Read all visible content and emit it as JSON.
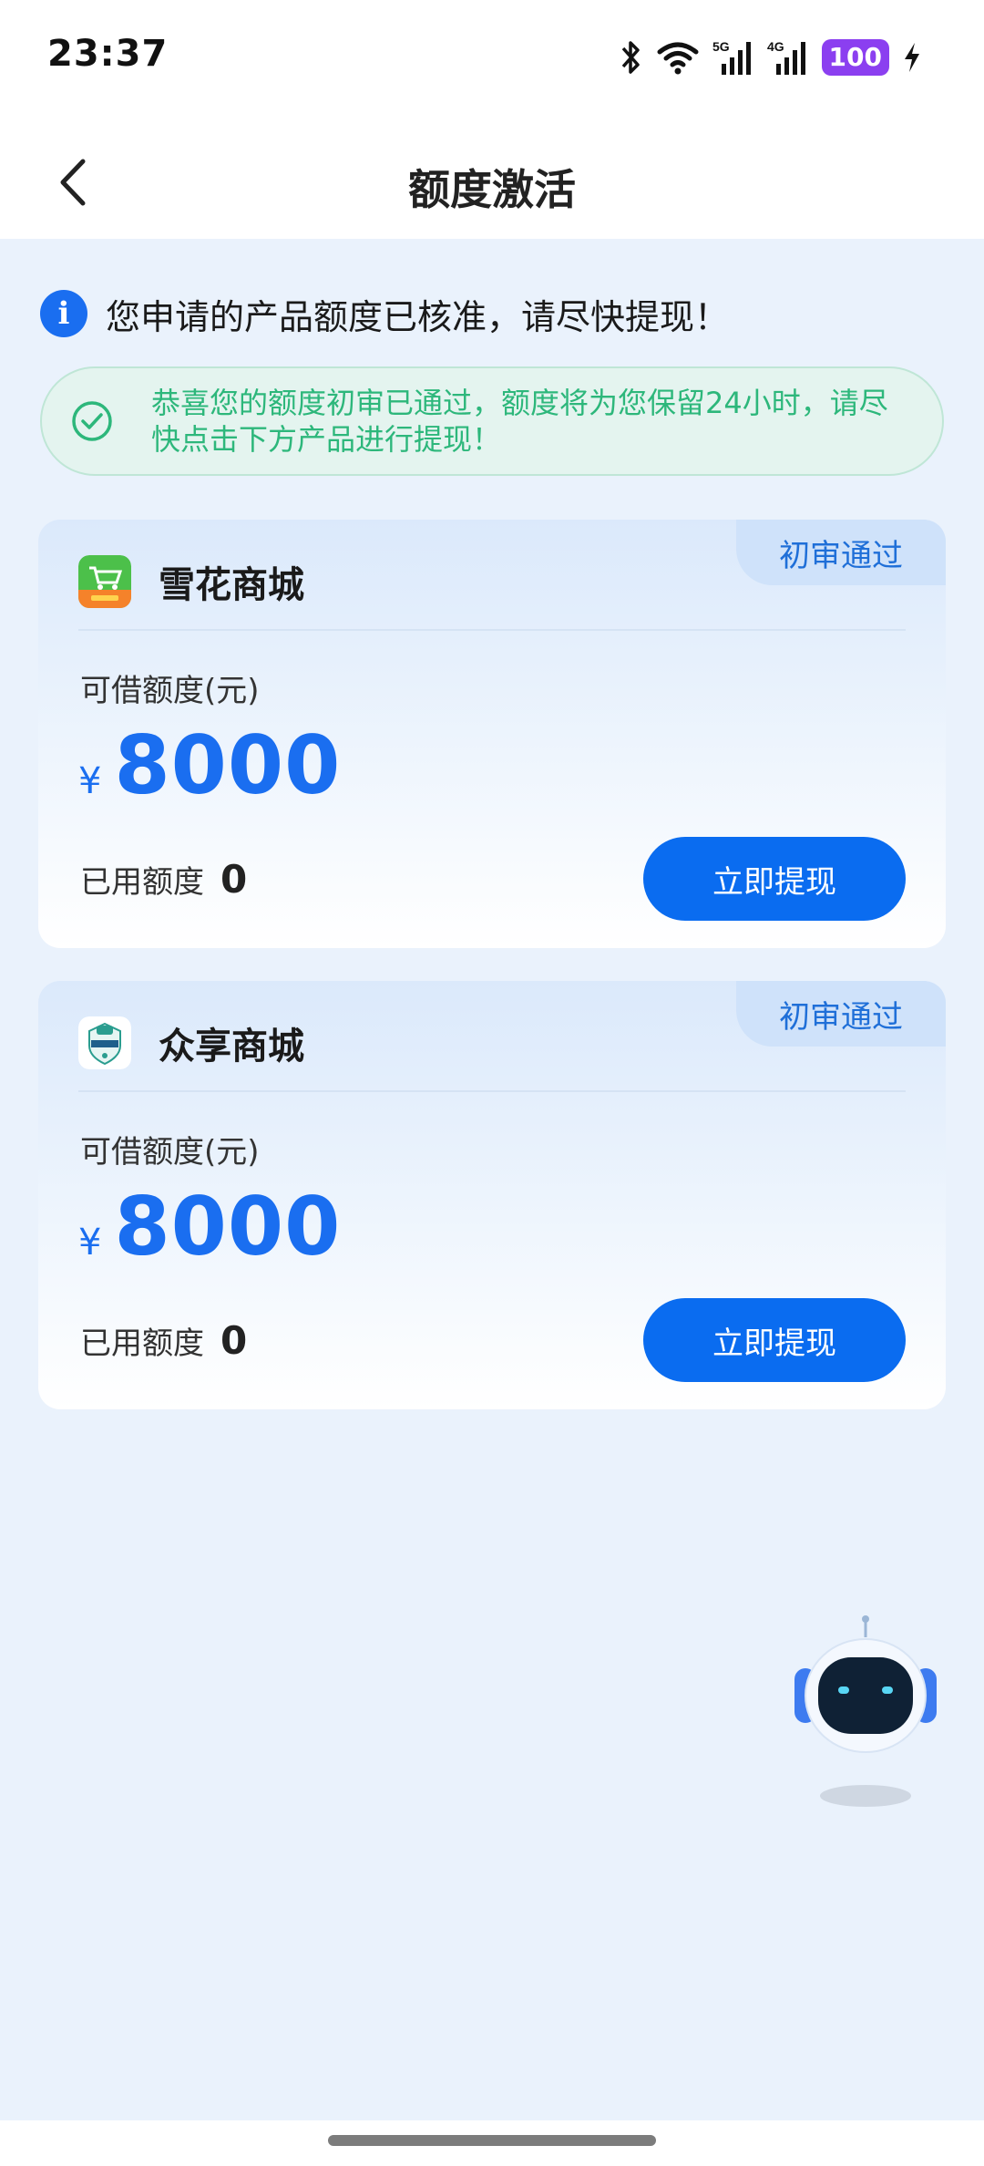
{
  "status_bar": {
    "time": "23:37",
    "battery": "100",
    "icons": [
      "bluetooth-icon",
      "wifi-icon",
      "signal-5g-icon",
      "signal-4g-icon",
      "battery-icon",
      "charging-icon"
    ]
  },
  "nav": {
    "title": "额度激活",
    "back_icon": "chevron-left-icon"
  },
  "notice": {
    "text": "您申请的产品额度已核准，请尽快提现！",
    "icon": "info-icon"
  },
  "success_banner": {
    "text": "恭喜您的额度初审已通过，额度将为您保留24小时，请尽快点击下方产品进行提现！",
    "icon": "check-circle-icon"
  },
  "products": [
    {
      "name": "雪花商城",
      "badge": "初审通过",
      "limit_label": "可借额度(元)",
      "currency": "¥",
      "amount": "8000",
      "used_label": "已用额度",
      "used_value": "0",
      "button_label": "立即提现",
      "logo": "xuehua-mall-logo"
    },
    {
      "name": "众享商城",
      "badge": "初审通过",
      "limit_label": "可借额度(元)",
      "currency": "¥",
      "amount": "8000",
      "used_label": "已用额度",
      "used_value": "0",
      "button_label": "立即提现",
      "logo": "zhongxiang-mall-logo"
    }
  ],
  "assistant": {
    "icon": "robot-assistant-icon"
  },
  "colors": {
    "primary": "#0a6cf0",
    "success": "#2db77b",
    "background": "#eaf2fc",
    "battery": "#8b3ff0"
  }
}
